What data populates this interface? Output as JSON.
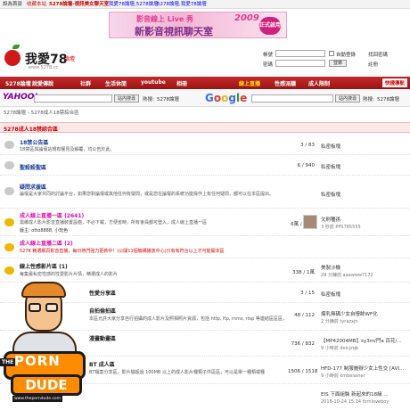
{
  "topbar": {
    "home": "設為首頁",
    "fav": "收藏本站",
    "links": [
      "5278論壇-視訊美女聊天室",
      "我愛78論壇,5278論壇",
      "5278論壇,我愛78論壇"
    ]
  },
  "banner": {
    "line1": "影音線上 Live 秀",
    "year": "2009",
    "line2": "新影音視訊聊天室",
    "button": "正式啟用"
  },
  "logo": {
    "text": "我愛78",
    "sub": "論壇",
    "url": "www.5278.cc"
  },
  "login": {
    "account_label": "帳號",
    "password_label": "密碼",
    "remember": "自動登錄",
    "forgot": "找回密碼",
    "login_btn": "登錄",
    "register": "註冊"
  },
  "nav": {
    "items": [
      "5278論壇",
      "說愛傳說",
      "社群",
      "生活休閒",
      "youtube",
      "相冊",
      "線上直播",
      "性感派議",
      "成人限制"
    ],
    "quick": "快捷導航"
  },
  "search": {
    "yahoo": "YAHOO!",
    "yahoo_sub": "奇摩",
    "btn1": "站內搜尋",
    "hot_label": "熱搜:",
    "hot_value": "5278論壇",
    "google_btn": "站內搜尋",
    "google_hot_label": "熱搜:",
    "google_hot_value": "5278論壇"
  },
  "breadcrumb": "5278論壇 › 5278成人18禁綜合區",
  "section": {
    "title": "5278成人18禁綜合區"
  },
  "forums": [
    {
      "title": "18禁公告區",
      "desc": "18禁區與論壇站規有權見及解覆，均公告於此。",
      "stat": "3 / 83",
      "last": "私密板塊"
    },
    {
      "title": "聖殺殺聖區",
      "desc": "",
      "stat": "6 / 940",
      "last": "私密板塊"
    },
    {
      "title": "疑問求援區",
      "desc": "論壇是大家共同的討論平台，如果您對論壇或其他任何有疑問，或是您在論壇的系統功能操作上有任何疑問，都可以在本區提出。",
      "stat": "",
      "last": "私密板塊"
    },
    {
      "title": "成人線上直播一區 (2641)",
      "desc": "需維成人影片影音直播裝置設施，不必下載，方便省時，所有會員都可登入，成人線上直播一區",
      "mod": "版主: otto8888, 小玩色",
      "stat": "6萬 / 17萬",
      "last": "欠刷種孫",
      "lastsub": "3 秒前 PPS785555"
    },
    {
      "title": "成人線上直播二區 (2)",
      "desc": "5278 精選網頁影音直播，每日熱門強力更新中！(公開11個機構播放中心)只有有符合以上才可能開本區",
      "stat": "",
      "last": ""
    },
    {
      "title": "線上性感影片區 (1)",
      "desc": "每集最私密性感的性愛影片片情，精選成人的影片",
      "stat": "338 / 1萬",
      "last": "美製沙機",
      "lastsub": "29 分鐘前 aaawww7172"
    },
    {
      "title": "性愛分享區",
      "desc": "",
      "stat": "3 / 15",
      "last": "私密板塊"
    },
    {
      "title": "自拍偷拍區",
      "desc": "本區允許大家分享自行拍攝的成人影片及照相照片資源，包括 http, ftp, mms, rtsp 等連結區區區，禁止發佈使用，以需需要下載的影片區區。",
      "stat": "48 / 112",
      "last": "爆乳無碼少女自慢眸WF化",
      "lastsub": "2 分鐘前 tyrazxjn"
    },
    {
      "title": "漫畫動畫區",
      "desc": "",
      "stat": "736 / 832",
      "last": "【MP42004MB】sy3m/門a 百花/...",
      "lastsub": "9 小時前 dolcjzqb"
    },
    {
      "title": "BT 成人區",
      "desc": "BT檔案分享區，影片檔超過 100MB 以上的成人影片種類子件區區，可以是單一種類或種",
      "stat": "1506 / 1518",
      "last": "HFD-177 制服麗辦少女上性交 [AVI...",
      "lastsub": "9 小時前 kmbelainer"
    },
    {
      "title": "",
      "desc": "",
      "stat": "",
      "last": "EIS 下面組裝 新起來的18緣 ...",
      "lastsub": "2018-10-24 15:14 fornloveboy"
    }
  ],
  "porndude": {
    "the": "THE",
    "porn": "PORN",
    "dude": "DUDE",
    "url": "www.theporndude.com"
  },
  "colors": {
    "nav_red": "#b51e1e",
    "link_blue": "#1a3c91",
    "section_bg": "#fde8e8",
    "hot_pink": "#e00fa9"
  }
}
